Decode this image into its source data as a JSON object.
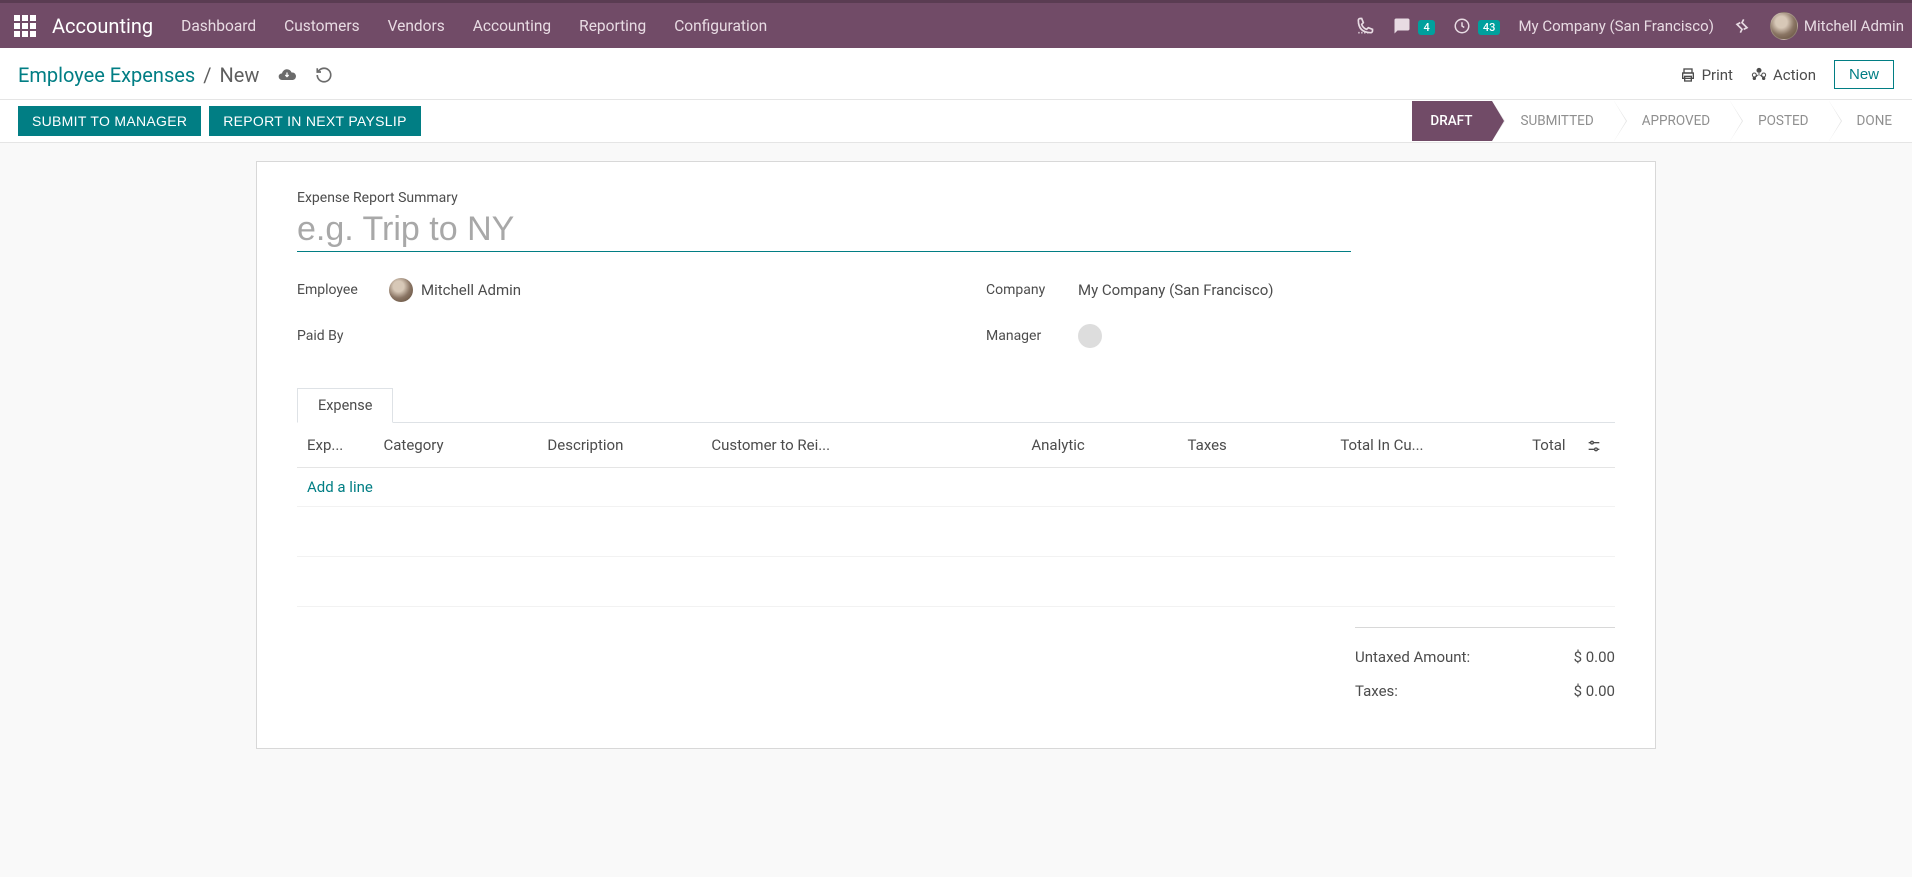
{
  "colors": {
    "brand": "#714B67",
    "accent": "#017e84",
    "badge": "#00a09d"
  },
  "navbar": {
    "brand": "Accounting",
    "menu": [
      "Dashboard",
      "Customers",
      "Vendors",
      "Accounting",
      "Reporting",
      "Configuration"
    ],
    "messages_badge": "4",
    "activities_badge": "43",
    "company": "My Company (San Francisco)",
    "user": "Mitchell Admin"
  },
  "control_panel": {
    "breadcrumb_parent": "Employee Expenses",
    "breadcrumb_current": "New",
    "print_label": "Print",
    "action_label": "Action",
    "new_label": "New"
  },
  "buttons": {
    "submit": "SUBMIT TO MANAGER",
    "report_payslip": "REPORT IN NEXT PAYSLIP"
  },
  "status": {
    "steps": [
      "DRAFT",
      "SUBMITTED",
      "APPROVED",
      "POSTED",
      "DONE"
    ],
    "active_index": 0
  },
  "form": {
    "summary_label": "Expense Report Summary",
    "summary_placeholder": "e.g. Trip to NY",
    "summary_value": "",
    "labels": {
      "employee": "Employee",
      "paid_by": "Paid By",
      "company": "Company",
      "manager": "Manager"
    },
    "employee": "Mitchell Admin",
    "paid_by": "",
    "company": "My Company (San Francisco)",
    "manager": ""
  },
  "tabs": {
    "expense": "Expense"
  },
  "expense_table": {
    "columns": [
      "Exp...",
      "Category",
      "Description",
      "Customer to Rei...",
      "Analytic",
      "Taxes",
      "Total In Cu...",
      "Total"
    ],
    "add_line": "Add a line",
    "rows": []
  },
  "totals": {
    "untaxed_label": "Untaxed Amount:",
    "untaxed_value": "$ 0.00",
    "taxes_label": "Taxes:",
    "taxes_value": "$ 0.00"
  }
}
